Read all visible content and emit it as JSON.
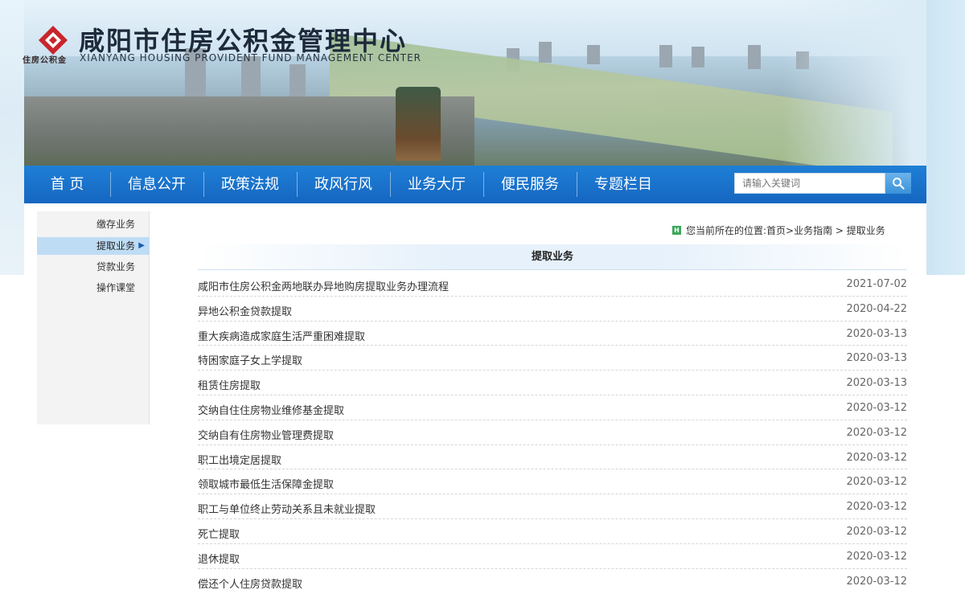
{
  "header": {
    "title": "咸阳市住房公积金管理中心",
    "subtitle": "XIANYANG HOUSING PROVIDENT FUND MANAGEMENT CENTER",
    "logo_caption": "住房公积金"
  },
  "nav": {
    "items": [
      {
        "label": "首 页"
      },
      {
        "label": "信息公开"
      },
      {
        "label": "政策法规"
      },
      {
        "label": "政风行风"
      },
      {
        "label": "业务大厅"
      },
      {
        "label": "便民服务"
      },
      {
        "label": "专题栏目"
      }
    ]
  },
  "search": {
    "placeholder": "请输入关键词",
    "icon": "search-icon"
  },
  "sidebar": {
    "items": [
      {
        "label": "缴存业务",
        "active": false
      },
      {
        "label": "提取业务",
        "active": true
      },
      {
        "label": "贷款业务",
        "active": false
      },
      {
        "label": "操作课堂",
        "active": false
      }
    ],
    "active_arrow": "▶"
  },
  "breadcrumb": {
    "icon": "H",
    "prefix": "您当前所在的位置:",
    "path": "首页>业务指南 > 提取业务"
  },
  "section": {
    "title": "提取业务"
  },
  "articles": [
    {
      "title": "咸阳市住房公积金两地联办异地购房提取业务办理流程",
      "date": "2021-07-02"
    },
    {
      "title": "异地公积金贷款提取",
      "date": "2020-04-22"
    },
    {
      "title": "重大疾病造成家庭生活严重困难提取",
      "date": "2020-03-13"
    },
    {
      "title": "特困家庭子女上学提取",
      "date": "2020-03-13"
    },
    {
      "title": "租赁住房提取",
      "date": "2020-03-13"
    },
    {
      "title": "交纳自住住房物业维修基金提取",
      "date": "2020-03-12"
    },
    {
      "title": "交纳自有住房物业管理费提取",
      "date": "2020-03-12"
    },
    {
      "title": "职工出境定居提取",
      "date": "2020-03-12"
    },
    {
      "title": "领取城市最低生活保障金提取",
      "date": "2020-03-12"
    },
    {
      "title": "职工与单位终止劳动关系且未就业提取",
      "date": "2020-03-12"
    },
    {
      "title": "死亡提取",
      "date": "2020-03-12"
    },
    {
      "title": "退休提取",
      "date": "2020-03-12"
    },
    {
      "title": "偿还个人住房贷款提取",
      "date": "2020-03-12"
    }
  ],
  "colors": {
    "nav_blue": "#1a72cc",
    "active_side": "#bfdcf5",
    "crumb_icon": "#3aa65a"
  }
}
